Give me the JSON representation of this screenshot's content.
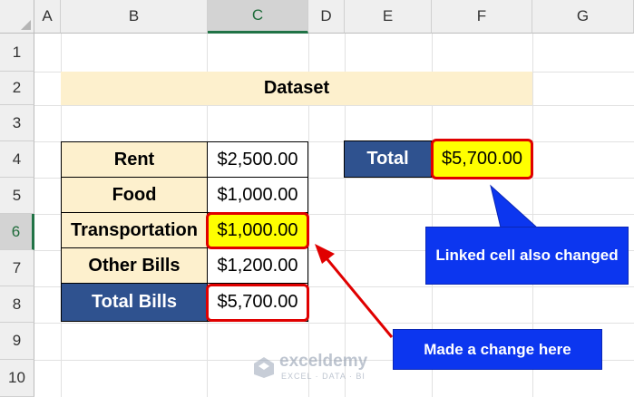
{
  "columns": [
    "A",
    "B",
    "C",
    "D",
    "E",
    "F",
    "G"
  ],
  "rows": [
    "1",
    "2",
    "3",
    "4",
    "5",
    "6",
    "7",
    "8",
    "9",
    "10"
  ],
  "selected": {
    "column": "C",
    "row": "6"
  },
  "dataset_title": "Dataset",
  "table": [
    {
      "label": "Rent",
      "value": "$2,500.00"
    },
    {
      "label": "Food",
      "value": "$1,000.00"
    },
    {
      "label": "Transportation",
      "value": "$1,000.00"
    },
    {
      "label": "Other Bills",
      "value": "$1,200.00"
    },
    {
      "label": "Total Bills",
      "value": "$5,700.00"
    }
  ],
  "linked": {
    "label": "Total",
    "value": "$5,700.00"
  },
  "callouts": {
    "linked": "Linked cell also changed",
    "change": "Made a change here"
  },
  "watermark": {
    "brand": "exceldemy",
    "tagline": "EXCEL · DATA · BI"
  },
  "colors": {
    "header_fill": "#efefef",
    "selection_green": "#217346",
    "label_fill": "#fdf0cd",
    "dark_fill": "#2f528f",
    "highlight_yellow": "#ffff00",
    "emphasis_red": "#e00000",
    "callout_blue": "#0c36ef"
  }
}
